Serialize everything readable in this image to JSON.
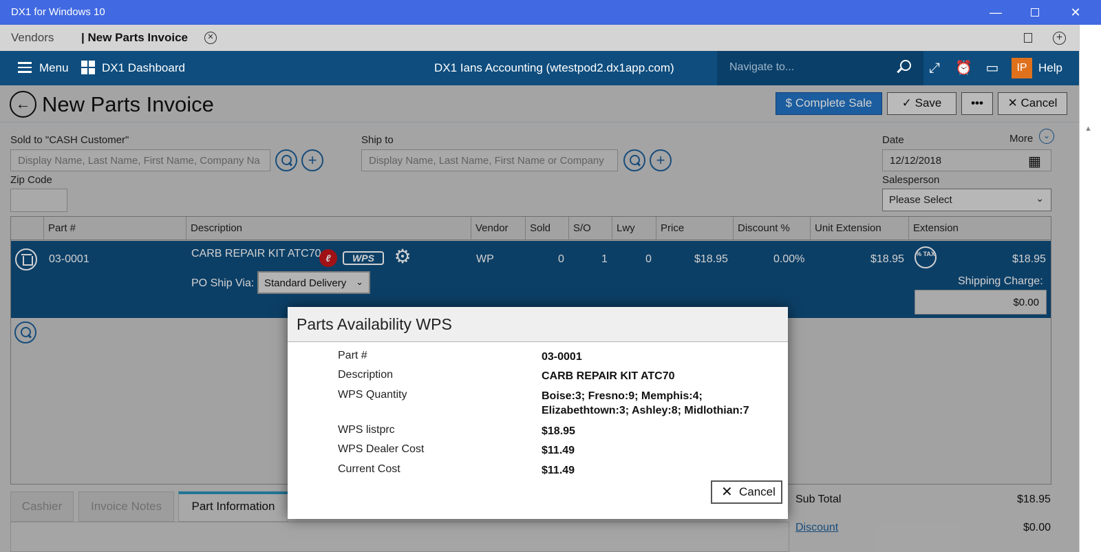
{
  "window": {
    "title": "DX1 for Windows 10"
  },
  "tabs": {
    "vendors": "Vendors",
    "new_invoice": "| New Parts Invoice"
  },
  "nav": {
    "menu": "Menu",
    "dashboard": "DX1 Dashboard",
    "center": "DX1 Ians Accounting (wtestpod2.dx1app.com)",
    "search_placeholder": "Navigate to...",
    "avatar": "IP",
    "help": "Help"
  },
  "page": {
    "title": "New Parts Invoice",
    "buttons": {
      "complete_sale": "Complete Sale",
      "save": "Save",
      "more": "•••",
      "cancel": "Cancel"
    }
  },
  "form": {
    "sold_to_label": "Sold to  \"CASH Customer\"",
    "sold_to_placeholder": "Display Name, Last Name, First Name, Company Na",
    "ship_to_label": "Ship to",
    "ship_to_placeholder": "Display Name, Last Name, First Name or Company",
    "zip_label": "Zip Code",
    "date_label": "Date",
    "date_value": "12/12/2018",
    "more_label": "More",
    "salesperson_label": "Salesperson",
    "salesperson_value": "Please Select"
  },
  "table": {
    "headers": [
      "Part #",
      "Description",
      "Vendor",
      "Sold",
      "S/O",
      "Lwy",
      "Price",
      "Discount %",
      "Unit Extension",
      "Extension"
    ],
    "row": {
      "part": "03-0001",
      "description": "CARB REPAIR KIT ATC70",
      "wps_logo": "WPS",
      "vendor": "WP",
      "sold": "0",
      "so": "1",
      "lwy": "0",
      "price": "$18.95",
      "discount": "0.00%",
      "unit_extension": "$18.95",
      "extension": "$18.95",
      "po_ship_label": "PO Ship Via:",
      "po_ship_value": "Standard Delivery",
      "shipping_label": "Shipping Charge:",
      "shipping_value": "$0.00",
      "tax_icon": "% TAX"
    }
  },
  "bottom_tabs": [
    "Cashier",
    "Invoice Notes",
    "Part Information"
  ],
  "totals": {
    "subtotal_label": "Sub Total",
    "subtotal_value": "$18.95",
    "discount_label": "Discount",
    "discount_value": "$0.00"
  },
  "modal": {
    "title": "Parts Availability WPS",
    "rows": [
      {
        "label": "Part #",
        "value": "03-0001"
      },
      {
        "label": "Description",
        "value": "CARB REPAIR KIT ATC70"
      },
      {
        "label": "WPS Quantity",
        "value": "Boise:3; Fresno:9; Memphis:4; Elizabethtown:3; Ashley:8; Midlothian:7"
      },
      {
        "label": "WPS listprc",
        "value": "$18.95"
      },
      {
        "label": "WPS Dealer Cost",
        "value": "$11.49"
      },
      {
        "label": "Current Cost",
        "value": "$11.49"
      }
    ],
    "cancel": "Cancel"
  },
  "colors": {
    "titlebar": "#4169e1",
    "navbar": "#0e4d7e",
    "selected_row": "#0f4d7d",
    "primary_button": "#2172c2",
    "avatar": "#e0711c"
  }
}
